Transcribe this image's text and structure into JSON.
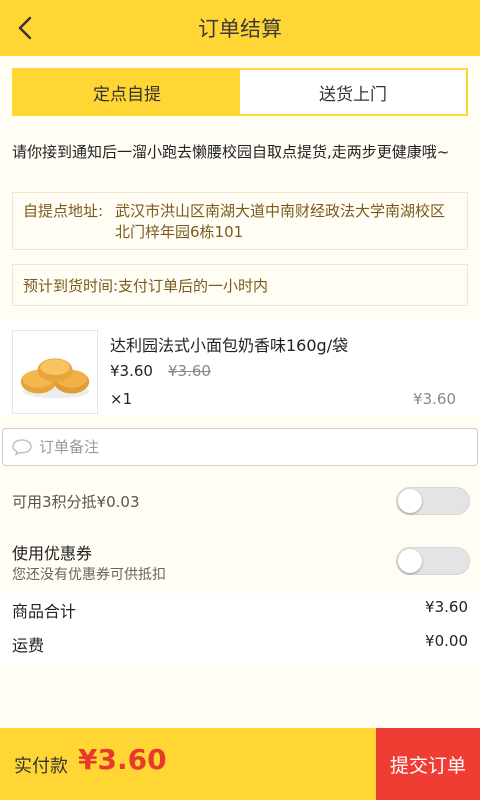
{
  "header": {
    "title": "订单结算",
    "back_icon": "back-chevron-icon"
  },
  "tabs": [
    {
      "label": "定点自提",
      "active": true
    },
    {
      "label": "送货上门",
      "active": false
    }
  ],
  "notice": "请你接到通知后一溜小跑去懒腰校园自取点提货,走两步更健康哦~",
  "pickup": {
    "address_label": "自提点地址:",
    "address_value": "武汉市洪山区南湖大道中南财经政法大学南湖校区北门梓年园6栋101",
    "eta": "预计到货时间:支付订单后的一小时内"
  },
  "product": {
    "name": "达利园法式小面包奶香味160g/袋",
    "price": "¥3.60",
    "original_price": "¥3.60",
    "quantity": "×1",
    "subtotal": "¥3.60"
  },
  "remark": {
    "placeholder": "订单备注",
    "value": ""
  },
  "points": {
    "label": "可用3积分抵¥0.03",
    "enabled": false
  },
  "coupon": {
    "title": "使用优惠券",
    "subtitle": "您还没有优惠券可供抵扣",
    "enabled": false
  },
  "summary": {
    "goods_label": "商品合计",
    "goods_value": "¥3.60",
    "shipping_label": "运费",
    "shipping_value": "¥0.00"
  },
  "footer": {
    "pay_label": "实付款",
    "pay_amount": "¥3.60",
    "submit_label": "提交订单"
  },
  "colors": {
    "accent": "#ffd633",
    "price_red": "#e8392e",
    "submit_red": "#ef3d33",
    "brown_text": "#7a5a1e"
  }
}
